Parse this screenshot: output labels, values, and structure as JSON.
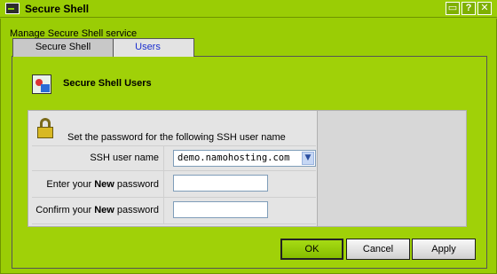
{
  "window": {
    "title": "Secure Shell",
    "controls": [
      "minimize-icon",
      "help-icon",
      "close-icon"
    ],
    "control_glyphs": {
      "minimize": "▭",
      "help": "?",
      "close": "✕"
    }
  },
  "subtitle": "Manage Secure Shell service",
  "tabs": [
    {
      "label": "Secure Shell",
      "active": true
    },
    {
      "label": "Users",
      "active": false
    }
  ],
  "section": {
    "title": "Secure Shell Users",
    "icon": "users-icon"
  },
  "form": {
    "icon": "lock-icon",
    "intro": "Set the password for the following SSH user name",
    "ssh_user_label": "SSH user name",
    "ssh_user_value": "demo.namohosting.com",
    "new_password_label_pre": "Enter your ",
    "new_password_label_bold": "New",
    "new_password_label_post": " password",
    "confirm_password_label_pre": "Confirm your ",
    "confirm_password_label_bold": "New",
    "confirm_password_label_post": " password",
    "new_password_value": "",
    "confirm_password_value": ""
  },
  "buttons": {
    "ok": "OK",
    "cancel": "Cancel",
    "apply": "Apply"
  },
  "colors": {
    "background": "#9acd05",
    "panel": "#a0d108",
    "form_bg": "#e4e4e4",
    "tab_users_text": "#1b2fcf"
  }
}
